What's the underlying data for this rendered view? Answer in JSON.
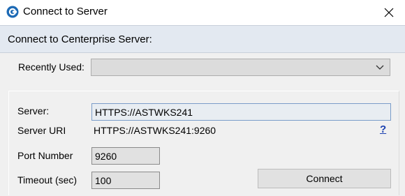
{
  "window": {
    "title": "Connect to Server",
    "icon": "centerprise-logo-icon"
  },
  "header": {
    "text": "Connect to Centerprise Server:"
  },
  "recently_used": {
    "label": "Recently Used:",
    "value": ""
  },
  "server": {
    "label": "Server:",
    "value": "HTTPS://ASTWKS241"
  },
  "server_uri": {
    "label": "Server URI",
    "value": "HTTPS://ASTWKS241:9260",
    "help": "?"
  },
  "port": {
    "label": "Port Number",
    "value": "9260"
  },
  "timeout": {
    "label": "Timeout (sec)",
    "value": "100"
  },
  "connect_button": {
    "label": "Connect"
  },
  "colors": {
    "accent": "#1a40b0",
    "header_bg": "#e3e9f1",
    "icon_blue": "#1d6ab5"
  }
}
